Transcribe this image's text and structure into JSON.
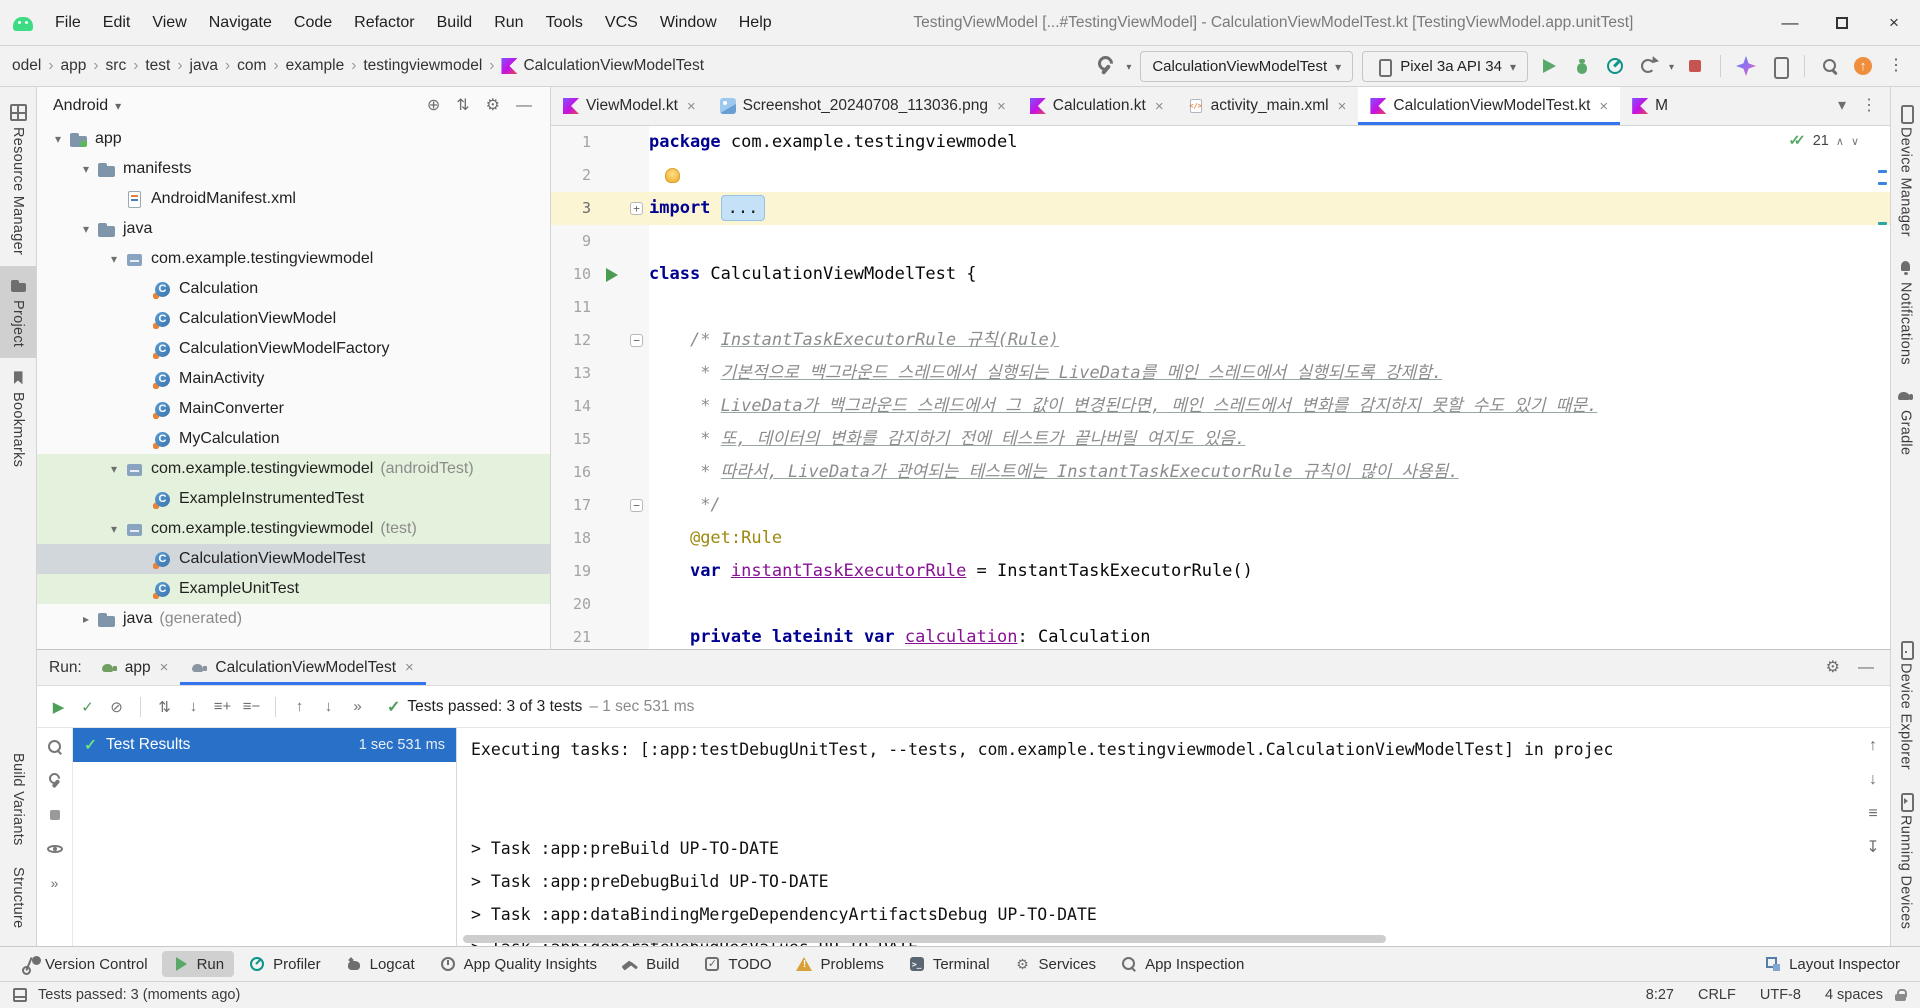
{
  "titlebar": {
    "menu": [
      "File",
      "Edit",
      "View",
      "Navigate",
      "Code",
      "Refactor",
      "Build",
      "Run",
      "Tools",
      "VCS",
      "Window",
      "Help"
    ],
    "title": "TestingViewModel [...#TestingViewModel] - CalculationViewModelTest.kt [TestingViewModel.app.unitTest]",
    "controls": {
      "minimize": "—",
      "close": "×"
    }
  },
  "toolbar": {
    "crumbs": [
      "odel",
      "app",
      "src",
      "test",
      "java",
      "com",
      "example",
      "testingviewmodel"
    ],
    "file_crumb": "CalculationViewModelTest",
    "run_config": "CalculationViewModelTest",
    "device": "Pixel 3a API 34"
  },
  "left_stripe": {
    "top": [
      {
        "label": "Resource Manager",
        "icon": "resource-manager"
      },
      {
        "label": "Project",
        "icon": "project-folder",
        "state": "active"
      },
      {
        "label": "Bookmarks",
        "icon": "bookmark"
      }
    ],
    "bottom": [
      {
        "label": "Build Variants"
      },
      {
        "label": "Structure"
      }
    ]
  },
  "right_stripe": {
    "top": [
      {
        "label": "Device Manager",
        "icon": "device-manager"
      },
      {
        "label": "Notifications",
        "icon": "bell"
      },
      {
        "label": "Gradle",
        "icon": "gradle-el"
      }
    ],
    "bottom": [
      {
        "label": "Device Explorer",
        "icon": "device-explorer"
      },
      {
        "label": "Running Devices",
        "icon": "running-devices"
      }
    ]
  },
  "project": {
    "view": "Android",
    "header_icons": [
      {
        "name": "select-opened-file",
        "glyph": "⊕"
      },
      {
        "name": "expand-collapse",
        "glyph": "⇅"
      },
      {
        "name": "panel-settings",
        "glyph": "⚙"
      },
      {
        "name": "hide-panel",
        "glyph": "—"
      }
    ],
    "tree": [
      {
        "arrow": "▾",
        "icon": "folder-app",
        "label": "app",
        "level": 0
      },
      {
        "arrow": "▾",
        "icon": "folder",
        "label": "manifests",
        "level": 1
      },
      {
        "arrow": "",
        "icon": "manifest",
        "label": "AndroidManifest.xml",
        "level": 2
      },
      {
        "arrow": "▾",
        "icon": "folder",
        "label": "java",
        "level": 1
      },
      {
        "arrow": "▾",
        "icon": "package",
        "label": "com.example.testingviewmodel",
        "level": 2
      },
      {
        "arrow": "",
        "icon": "kclass",
        "label": "Calculation",
        "level": 3
      },
      {
        "arrow": "",
        "icon": "kclass",
        "label": "CalculationViewModel",
        "level": 3
      },
      {
        "arrow": "",
        "icon": "kclass",
        "label": "CalculationViewModelFactory",
        "level": 3
      },
      {
        "arrow": "",
        "icon": "kclass",
        "label": "MainActivity",
        "level": 3
      },
      {
        "arrow": "",
        "icon": "kclass",
        "label": "MainConverter",
        "level": 3
      },
      {
        "arrow": "",
        "icon": "kclass",
        "label": "MyCalculation",
        "level": 3
      },
      {
        "arrow": "▾",
        "icon": "package",
        "label": "com.example.testingviewmodel",
        "suffix": "(androidTest)",
        "level": 2,
        "bg": "green"
      },
      {
        "arrow": "",
        "icon": "kclass",
        "label": "ExampleInstrumentedTest",
        "level": 3,
        "bg": "green"
      },
      {
        "arrow": "▾",
        "icon": "package",
        "label": "com.example.testingviewmodel",
        "suffix": "(test)",
        "level": 2,
        "bg": "green"
      },
      {
        "arrow": "",
        "icon": "kclass",
        "label": "CalculationViewModelTest",
        "level": 3,
        "bg": "selected"
      },
      {
        "arrow": "",
        "icon": "kclass",
        "label": "ExampleUnitTest",
        "level": 3,
        "bg": "green"
      },
      {
        "arrow": "▸",
        "icon": "folder",
        "label": "java",
        "suffix": "(generated)",
        "level": 1
      }
    ]
  },
  "editor": {
    "tabs": [
      {
        "icon": "kfile",
        "label": "ViewModel.kt",
        "close": "×"
      },
      {
        "icon": "imgfile",
        "label": "Screenshot_20240708_113036.png",
        "close": "×"
      },
      {
        "icon": "kfile",
        "label": "Calculation.kt",
        "close": "×"
      },
      {
        "icon": "xmlfile",
        "label": "activity_main.xml",
        "close": "×"
      },
      {
        "icon": "kfile",
        "label": "CalculationViewModelTest.kt",
        "close": "×",
        "state": "active"
      },
      {
        "icon": "kfile",
        "label": "M"
      }
    ],
    "tab_icons_right": [
      {
        "name": "show-hidden-tabs",
        "glyph": "▾"
      },
      {
        "name": "editor-options",
        "glyph": "⋮"
      }
    ],
    "inspections": {
      "count": "21"
    },
    "lines": [
      {
        "num": 1,
        "segs": [
          {
            "t": "package ",
            "c": "kw"
          },
          {
            "t": "com.example.testingviewmodel",
            "c": "pl"
          }
        ]
      },
      {
        "num": 2,
        "segs": [
          {
            "t": "",
            "c": "bulb"
          }
        ]
      },
      {
        "num": 3,
        "cur": true,
        "fold": "+",
        "segs": [
          {
            "t": "import ",
            "c": "kw"
          },
          {
            "t": "...",
            "c": "folded"
          }
        ]
      },
      {
        "num": 9,
        "segs": []
      },
      {
        "num": 10,
        "gutter": "run",
        "segs": [
          {
            "t": "class ",
            "c": "kw"
          },
          {
            "t": "CalculationViewModelTest {",
            "c": "pl"
          }
        ]
      },
      {
        "num": 11,
        "segs": []
      },
      {
        "num": 12,
        "fold": "−",
        "segs": [
          {
            "t": "    ",
            "c": "pl"
          },
          {
            "t": "/* ",
            "c": "cm"
          },
          {
            "t": "InstantTaskExecutorRule 규칙(Rule)",
            "c": "cmu"
          }
        ]
      },
      {
        "num": 13,
        "segs": [
          {
            "t": "     ",
            "c": "pl"
          },
          {
            "t": "* ",
            "c": "cm"
          },
          {
            "t": "기본적으로 백그라운드 스레드에서 실행되는 LiveData를 메인 스레드에서 실행되도록 강제함.",
            "c": "cmu"
          }
        ]
      },
      {
        "num": 14,
        "segs": [
          {
            "t": "     ",
            "c": "pl"
          },
          {
            "t": "* ",
            "c": "cm"
          },
          {
            "t": "LiveData가 백그라운드 스레드에서 그 값이 변경된다면, 메인 스레드에서 변화를 감지하지 못할 수도 있기 때문.",
            "c": "cmu"
          }
        ]
      },
      {
        "num": 15,
        "segs": [
          {
            "t": "     ",
            "c": "pl"
          },
          {
            "t": "* ",
            "c": "cm"
          },
          {
            "t": "또, 데이터의 변화를 감지하기 전에 테스트가 끝나버릴 여지도 있음.",
            "c": "cmu"
          }
        ]
      },
      {
        "num": 16,
        "segs": [
          {
            "t": "     ",
            "c": "pl"
          },
          {
            "t": "* ",
            "c": "cm"
          },
          {
            "t": "따라서, LiveData가 관여되는 테스트에는 InstantTaskExecutorRule 규칙이 많이 사용됨.",
            "c": "cmu"
          }
        ]
      },
      {
        "num": 17,
        "fold": "−",
        "segs": [
          {
            "t": "     ",
            "c": "pl"
          },
          {
            "t": "*/",
            "c": "cm"
          }
        ]
      },
      {
        "num": 18,
        "segs": [
          {
            "t": "    ",
            "c": "pl"
          },
          {
            "t": "@get:Rule",
            "c": "ann"
          }
        ]
      },
      {
        "num": 19,
        "segs": [
          {
            "t": "    ",
            "c": "pl"
          },
          {
            "t": "var ",
            "c": "kw"
          },
          {
            "t": "instantTaskExecutorRule",
            "c": "prop"
          },
          {
            "t": " = InstantTaskExecutorRule()",
            "c": "pl"
          }
        ]
      },
      {
        "num": 20,
        "segs": []
      },
      {
        "num": 21,
        "segs": [
          {
            "t": "    ",
            "c": "pl"
          },
          {
            "t": "private lateinit var ",
            "c": "kw"
          },
          {
            "t": "calculation",
            "c": "prop"
          },
          {
            "t": ": Calculation",
            "c": "pl"
          }
        ]
      }
    ]
  },
  "run_panel": {
    "label": "Run:",
    "tabs": [
      {
        "icon": "gradle-green",
        "label": "app",
        "close": "×"
      },
      {
        "icon": "gradle-gray",
        "label": "CalculationViewModelTest",
        "close": "×",
        "state": "active"
      }
    ],
    "header_icons": [
      {
        "name": "run-panel-settings",
        "glyph": "⚙"
      },
      {
        "name": "hide-run-panel",
        "glyph": "—"
      }
    ],
    "toolbar_icons": [
      {
        "name": "rerun-tests",
        "glyph": "▶",
        "cls": "green"
      },
      {
        "name": "rerun-failed-tests",
        "glyph": "✓",
        "cls": "green"
      },
      {
        "name": "stop-process",
        "glyph": "⊘",
        "cls": "gray"
      },
      {
        "name": "separator",
        "glyph": "",
        "cls": "sep"
      },
      {
        "name": "sort-alphabetically",
        "glyph": "⇅",
        "cls": "gray"
      },
      {
        "name": "sort-by-duration",
        "glyph": "↓",
        "cls": "gray"
      },
      {
        "name": "expand-all",
        "glyph": "≡+",
        "cls": "gray"
      },
      {
        "name": "collapse-all",
        "glyph": "≡−",
        "cls": "gray"
      },
      {
        "name": "separator",
        "glyph": "",
        "cls": "sep"
      },
      {
        "name": "previous-failed-test",
        "glyph": "↑",
        "cls": "gray"
      },
      {
        "name": "next-failed-test",
        "glyph": "↓",
        "cls": "gray"
      },
      {
        "name": "more-toolbar-options",
        "glyph": "»",
        "cls": "gray"
      }
    ],
    "status": {
      "main": "Tests passed: 3 of 3 tests",
      "time": "– 1 sec 531 ms"
    },
    "side_icons": [
      {
        "name": "import-test-results"
      },
      {
        "name": "test-runner-settings"
      },
      {
        "name": "suspend"
      },
      {
        "name": "show-passed"
      },
      {
        "name": "more-side-options",
        "glyph": "»"
      }
    ],
    "results": {
      "label": "Test Results",
      "time": "1 sec 531 ms"
    },
    "console": [
      "Executing tasks: [:app:testDebugUnitTest, --tests, com.example.testingviewmodel.CalculationViewModelTest] in projec",
      "",
      "",
      "> Task :app:preBuild UP-TO-DATE",
      "> Task :app:preDebugBuild UP-TO-DATE",
      "> Task :app:dataBindingMergeDependencyArtifactsDebug UP-TO-DATE",
      "> Task :app:generateDebugResValues UP-TO-DATE"
    ],
    "console_icons": [
      {
        "name": "scroll-up",
        "glyph": "↑"
      },
      {
        "name": "scroll-down",
        "glyph": "↓"
      },
      {
        "name": "soft-wrap",
        "glyph": "≡"
      },
      {
        "name": "scroll-to-end",
        "glyph": "↧"
      }
    ]
  },
  "bottom_bar": {
    "items": [
      {
        "icon": "version-control",
        "label": "Version Control"
      },
      {
        "icon": "run",
        "label": "Run",
        "state": "active"
      },
      {
        "icon": "profiler",
        "label": "Profiler"
      },
      {
        "icon": "logcat",
        "label": "Logcat"
      },
      {
        "icon": "app-quality-insights",
        "label": "App Quality Insights"
      },
      {
        "icon": "build",
        "label": "Build"
      },
      {
        "icon": "todo",
        "label": "TODO"
      },
      {
        "icon": "problems",
        "label": "Problems"
      },
      {
        "icon": "terminal",
        "label": "Terminal"
      },
      {
        "icon": "services",
        "label": "Services"
      },
      {
        "icon": "app-inspection",
        "label": "App Inspection"
      }
    ],
    "right": {
      "label": "Layout Inspector"
    }
  },
  "status_bar": {
    "message": "Tests passed: 3 (moments ago)",
    "right": [
      {
        "label": "8:27"
      },
      {
        "label": "CRLF"
      },
      {
        "label": "UTF-8"
      },
      {
        "label": "4 spaces"
      }
    ]
  }
}
